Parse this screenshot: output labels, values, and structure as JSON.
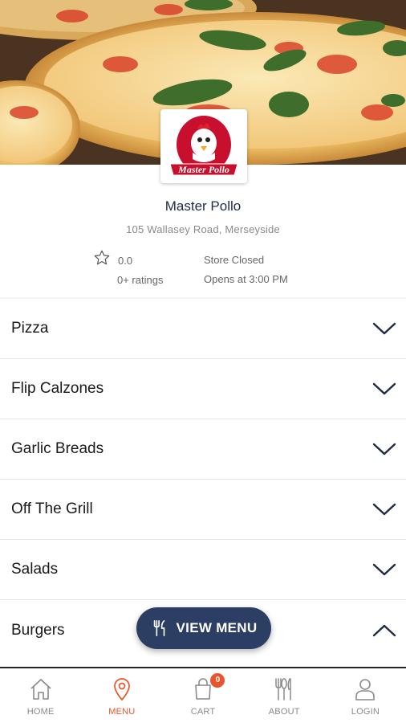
{
  "store": {
    "name": "Master Pollo",
    "address": "105 Wallasey Road, Merseyside",
    "logo_text": "Master Pollo",
    "rating_value": "0.0",
    "rating_count": "0+ ratings",
    "status": "Store Closed",
    "opens_at": "Opens at 3:00 PM"
  },
  "categories": [
    {
      "label": "Pizza",
      "expanded": false
    },
    {
      "label": "Flip Calzones",
      "expanded": false
    },
    {
      "label": "Garlic Breads",
      "expanded": false
    },
    {
      "label": "Off The Grill",
      "expanded": false
    },
    {
      "label": "Salads",
      "expanded": false
    },
    {
      "label": "Burgers",
      "expanded": true
    }
  ],
  "view_menu": {
    "label": "VIEW MENU",
    "icon": "cutlery-icon"
  },
  "bottom_nav": {
    "items": [
      {
        "label": "HOME",
        "icon": "home-icon",
        "active": false
      },
      {
        "label": "MENU",
        "icon": "location-pin-icon",
        "active": true
      },
      {
        "label": "CART",
        "icon": "shopping-bag-icon",
        "active": false
      },
      {
        "label": "ABOUT",
        "icon": "fork-knife-icon",
        "active": false
      },
      {
        "label": "LOGIN",
        "icon": "user-icon",
        "active": false
      }
    ],
    "cart_count": "0"
  },
  "colors": {
    "accent": "#e8542c",
    "button": "#2c3e63",
    "title": "#1f2a44"
  }
}
